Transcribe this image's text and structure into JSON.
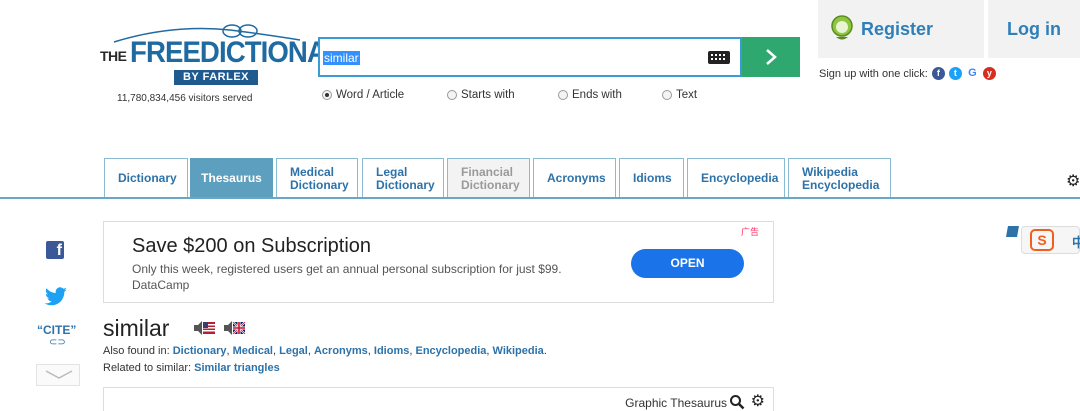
{
  "logo": {
    "the": "THE",
    "free_dictionary": "FREEDICTIONARY",
    "by_farlex": "BY FARLEX"
  },
  "visitors": "11,780,834,456 visitors served",
  "search": {
    "value": "similar",
    "options": [
      {
        "label": "Word / Article",
        "selected": true
      },
      {
        "label": "Starts with",
        "selected": false
      },
      {
        "label": "Ends with",
        "selected": false
      },
      {
        "label": "Text",
        "selected": false
      }
    ]
  },
  "account": {
    "register": "Register",
    "login": "Log in",
    "signup": "Sign up with one click:"
  },
  "tabs": [
    {
      "label": "Dictionary",
      "state": "normal"
    },
    {
      "label": "Thesaurus",
      "state": "active"
    },
    {
      "label": "Medical Dictionary",
      "state": "normal"
    },
    {
      "label": "Legal Dictionary",
      "state": "normal"
    },
    {
      "label": "Financial Dictionary",
      "state": "disabled"
    },
    {
      "label": "Acronyms",
      "state": "normal"
    },
    {
      "label": "Idioms",
      "state": "normal"
    },
    {
      "label": "Encyclopedia",
      "state": "normal"
    },
    {
      "label": "Wikipedia Encyclopedia",
      "state": "normal"
    }
  ],
  "share": {
    "cite": "“CITE”",
    "cite_sub": "⊂⊃"
  },
  "ad": {
    "marker": "广告",
    "title": "Save $200 on Subscription",
    "description": "Only this week, registered users get an annual personal subscription for just $99.",
    "brand": "DataCamp",
    "cta": "OPEN"
  },
  "sogou": {
    "s": "S",
    "zh": "中"
  },
  "entry": {
    "headword": "similar",
    "found_prefix": "Also found in:",
    "found_links": [
      "Dictionary",
      "Medical",
      "Legal",
      "Acronyms",
      "Idioms",
      "Encyclopedia",
      "Wikipedia"
    ],
    "related_prefix": "Related to similar:",
    "related_link": "Similar triangles",
    "graphic_thesaurus": "Graphic Thesaurus"
  },
  "colors": {
    "brand_blue": "#2d72a8",
    "tab_active": "#5c9fbe",
    "search_button": "#2fa870",
    "ad_button": "#1a73e8"
  }
}
